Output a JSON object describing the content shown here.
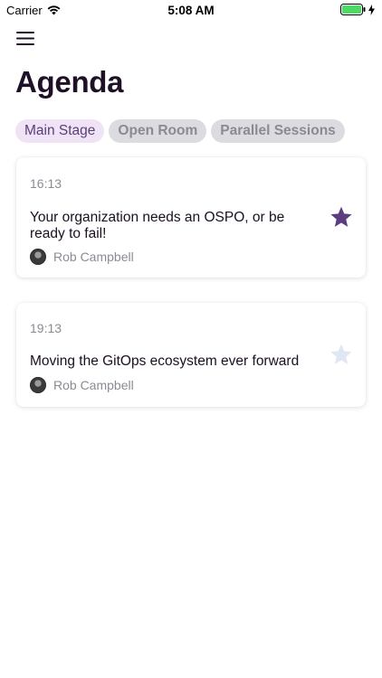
{
  "status_bar": {
    "carrier": "Carrier",
    "time": "5:08 AM"
  },
  "page": {
    "title": "Agenda"
  },
  "tabs": [
    {
      "label": "Main Stage",
      "active": true
    },
    {
      "label": "Open Room",
      "active": false
    },
    {
      "label": "Parallel Sessions",
      "active": false
    }
  ],
  "sessions": [
    {
      "time": "16:13",
      "title": "Your organization needs an OSPO, or be ready to fail!",
      "speaker": "Rob Campbell",
      "favorited": true
    },
    {
      "time": "19:13",
      "title": "Moving the GitOps ecosystem ever forward",
      "speaker": "Rob Campbell",
      "favorited": false
    }
  ],
  "colors": {
    "accent": "#5a3e77",
    "star_on": "#5b3d80",
    "star_off": "#e1e6f4",
    "tab_active_bg": "#f1e3f6",
    "tab_inactive_bg": "#dcdbe0",
    "battery": "#4cd964"
  }
}
